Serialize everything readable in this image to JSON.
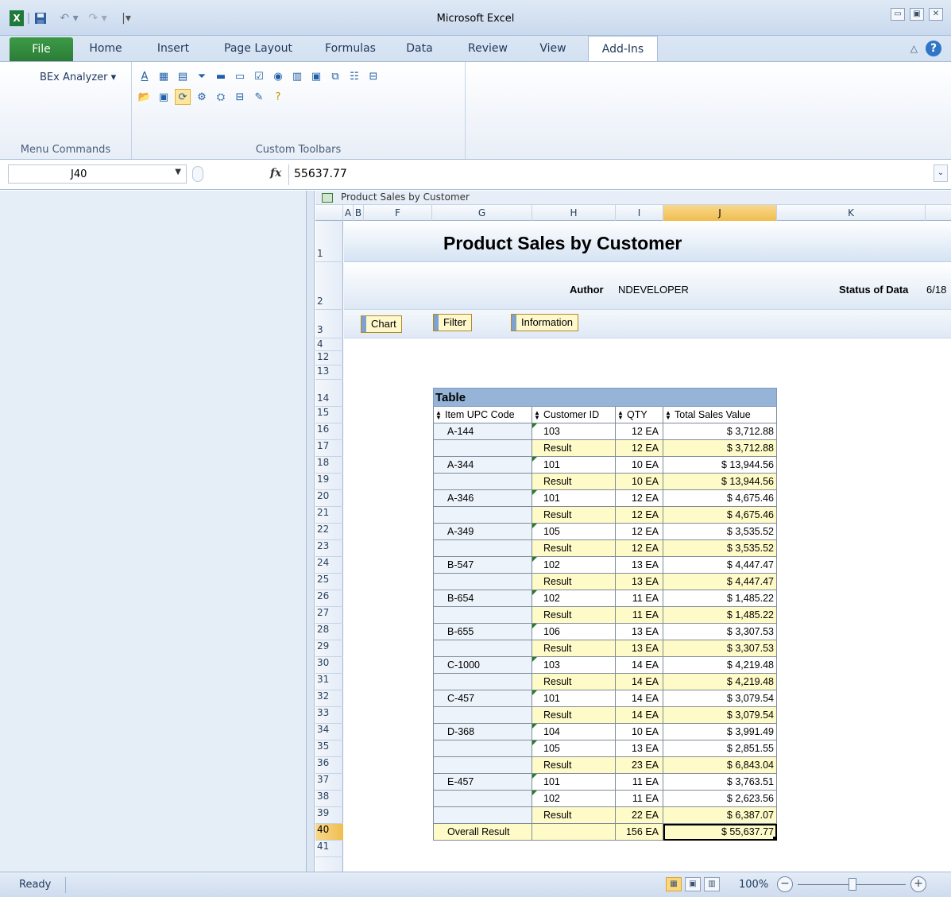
{
  "window": {
    "title": "Microsoft Excel",
    "qat": {
      "excel_icon": "excel-icon",
      "save_icon": "save-icon",
      "undo_icon": "undo-icon",
      "redo_icon": "redo-icon",
      "customize": "|▾"
    }
  },
  "ribbon": {
    "tabs": [
      "File",
      "Home",
      "Insert",
      "Page Layout",
      "Formulas",
      "Data",
      "Review",
      "View",
      "Add-Ins"
    ],
    "active_tab": "Add-Ins",
    "menu_commands": {
      "button_label": "BEx Analyzer ▾",
      "group_label": "Menu Commands"
    },
    "custom_toolbars": {
      "group_label": "Custom Toolbars"
    }
  },
  "formula_bar": {
    "name_box": "J40",
    "fx": "fx",
    "value": "55637.77"
  },
  "workbook": {
    "title": "Product Sales by Customer",
    "columns": [
      "A",
      "B",
      "F",
      "G",
      "H",
      "I",
      "J",
      "K"
    ],
    "selected_column": "J",
    "rows": [
      "1",
      "2",
      "3",
      "4",
      "12",
      "13",
      "14",
      "15",
      "16",
      "17",
      "18",
      "19",
      "20",
      "21",
      "22",
      "23",
      "24",
      "25",
      "26",
      "27",
      "28",
      "29",
      "30",
      "31",
      "32",
      "33",
      "34",
      "35",
      "36",
      "37",
      "38",
      "39",
      "40",
      "41"
    ],
    "selected_row": "40"
  },
  "report": {
    "title": "Product Sales by Customer",
    "author_label": "Author",
    "author_value": "NDEVELOPER",
    "status_label": "Status of Data",
    "status_value": "6/18",
    "buttons": {
      "chart": "Chart",
      "filter": "Filter",
      "information": "Information"
    }
  },
  "table": {
    "caption": "Table",
    "headers": [
      "Item UPC Code",
      "Customer ID",
      "QTY",
      "Total Sales Value"
    ],
    "rows": [
      {
        "item": "A-144",
        "customer": "103",
        "qty": "12 EA",
        "value": "$ 3,712.88",
        "type": "data"
      },
      {
        "item": "",
        "customer": "Result",
        "qty": "12 EA",
        "value": "$ 3,712.88",
        "type": "result"
      },
      {
        "item": "A-344",
        "customer": "101",
        "qty": "10 EA",
        "value": "$ 13,944.56",
        "type": "data"
      },
      {
        "item": "",
        "customer": "Result",
        "qty": "10 EA",
        "value": "$ 13,944.56",
        "type": "result"
      },
      {
        "item": "A-346",
        "customer": "101",
        "qty": "12 EA",
        "value": "$ 4,675.46",
        "type": "data"
      },
      {
        "item": "",
        "customer": "Result",
        "qty": "12 EA",
        "value": "$ 4,675.46",
        "type": "result"
      },
      {
        "item": "A-349",
        "customer": "105",
        "qty": "12 EA",
        "value": "$ 3,535.52",
        "type": "data"
      },
      {
        "item": "",
        "customer": "Result",
        "qty": "12 EA",
        "value": "$ 3,535.52",
        "type": "result"
      },
      {
        "item": "B-547",
        "customer": "102",
        "qty": "13 EA",
        "value": "$ 4,447.47",
        "type": "data"
      },
      {
        "item": "",
        "customer": "Result",
        "qty": "13 EA",
        "value": "$ 4,447.47",
        "type": "result"
      },
      {
        "item": "B-654",
        "customer": "102",
        "qty": "11 EA",
        "value": "$ 1,485.22",
        "type": "data"
      },
      {
        "item": "",
        "customer": "Result",
        "qty": "11 EA",
        "value": "$ 1,485.22",
        "type": "result"
      },
      {
        "item": "B-655",
        "customer": "106",
        "qty": "13 EA",
        "value": "$ 3,307.53",
        "type": "data"
      },
      {
        "item": "",
        "customer": "Result",
        "qty": "13 EA",
        "value": "$ 3,307.53",
        "type": "result"
      },
      {
        "item": "C-1000",
        "customer": "103",
        "qty": "14 EA",
        "value": "$ 4,219.48",
        "type": "data"
      },
      {
        "item": "",
        "customer": "Result",
        "qty": "14 EA",
        "value": "$ 4,219.48",
        "type": "result"
      },
      {
        "item": "C-457",
        "customer": "101",
        "qty": "14 EA",
        "value": "$ 3,079.54",
        "type": "data"
      },
      {
        "item": "",
        "customer": "Result",
        "qty": "14 EA",
        "value": "$ 3,079.54",
        "type": "result"
      },
      {
        "item": "D-368",
        "customer": "104",
        "qty": "10 EA",
        "value": "$ 3,991.49",
        "type": "data"
      },
      {
        "item": "",
        "customer": "105",
        "qty": "13 EA",
        "value": "$ 2,851.55",
        "type": "data2"
      },
      {
        "item": "",
        "customer": "Result",
        "qty": "23 EA",
        "value": "$ 6,843.04",
        "type": "result"
      },
      {
        "item": "E-457",
        "customer": "101",
        "qty": "11 EA",
        "value": "$ 3,763.51",
        "type": "data"
      },
      {
        "item": "",
        "customer": "102",
        "qty": "11 EA",
        "value": "$ 2,623.56",
        "type": "data2"
      },
      {
        "item": "",
        "customer": "Result",
        "qty": "22 EA",
        "value": "$ 6,387.07",
        "type": "result"
      },
      {
        "item": "Overall Result",
        "customer": "",
        "qty": "156 EA",
        "value": "$ 55,637.77",
        "type": "overall"
      }
    ]
  },
  "statusbar": {
    "ready": "Ready",
    "zoom": "100%",
    "zoom_level_percent": 100,
    "minus": "−",
    "plus": "+"
  }
}
